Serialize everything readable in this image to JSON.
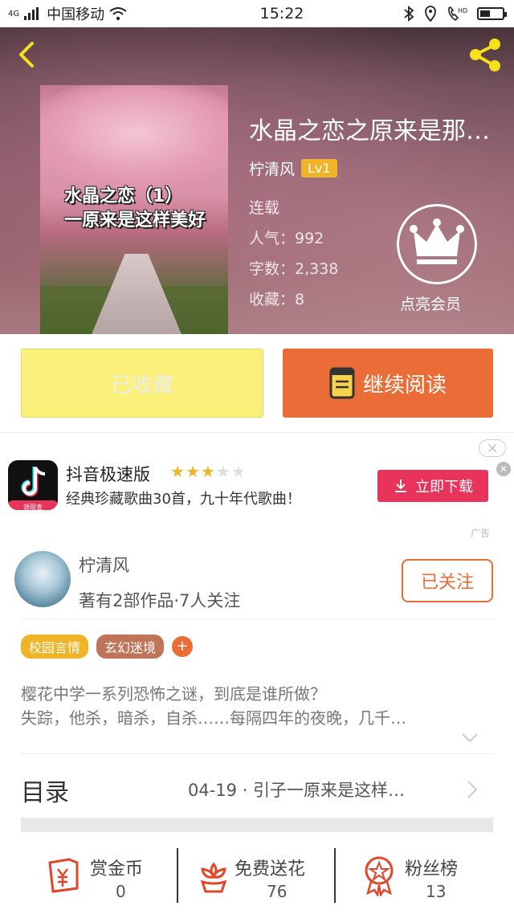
{
  "status_bar": {
    "carrier": "中国移动",
    "network": "4G",
    "time": "15:22",
    "hd_label": "HD"
  },
  "book": {
    "title": "水晶之恋之原来是那…",
    "cover_text_line1": "水晶之恋（1）",
    "cover_text_line2": "一原来是这样美好",
    "author": "柠清风",
    "level": "Lv1",
    "status": "连载",
    "popularity": "人气：992",
    "words": "字数：2,338",
    "favorites": "收藏：8"
  },
  "vip": {
    "label": "点亮会员"
  },
  "actions": {
    "favorited_label": "已收藏",
    "continue_label": "继续阅读"
  },
  "ad": {
    "title": "抖音极速版",
    "rating": 3,
    "rating_max": 5,
    "description": "经典珍藏歌曲30首，九十年代歌曲！",
    "download_label": "立即下载",
    "icon_tag": "领现金",
    "ad_mark": "广告"
  },
  "author": {
    "name": "柠清风",
    "info": "著有2部作品·7人关注",
    "follow_label": "已关注",
    "tags": [
      "校园言情",
      "玄幻迷境"
    ],
    "add_tag": "+"
  },
  "description": {
    "line1": "樱花中学一系列恐怖之谜，到底是谁所做？",
    "line2": "失踪，他杀，暗杀，自杀……每隔四年的夜晚，几千…"
  },
  "toc": {
    "label": "目录",
    "latest": "04-19 · 引子一原来是这样…"
  },
  "bottom_bar": {
    "items": [
      {
        "label": "赏金币",
        "value": "0",
        "icon": "reward-coin-icon"
      },
      {
        "label": "免费送花",
        "value": "76",
        "icon": "flower-icon"
      },
      {
        "label": "粉丝榜",
        "value": "13",
        "icon": "medal-icon"
      }
    ]
  },
  "colors": {
    "accent": "#ea6c37",
    "favorite_bg": "#faf07a",
    "level_badge": "#f0b429",
    "ad_download": "#e8345a"
  }
}
